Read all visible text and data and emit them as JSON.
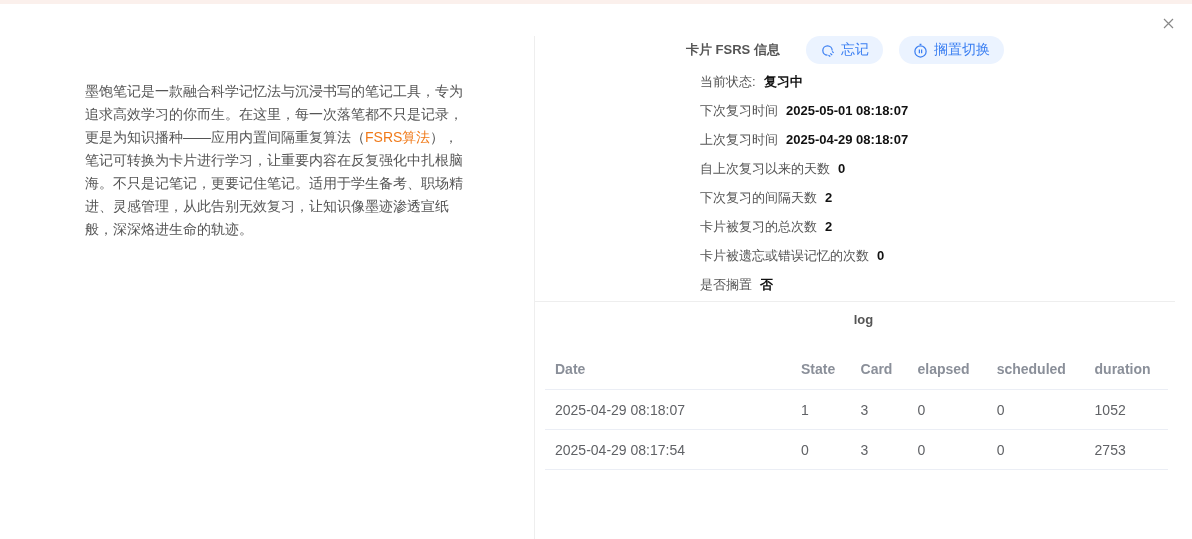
{
  "intro": {
    "before": "墨饱笔记是一款融合科学记忆法与沉浸书写的笔记工具，专为追求高效学习的你而生。在这里，每一次落笔都不只是记录，更是为知识播种——应用内置间隔重复算法（",
    "link": "FSRS算法",
    "after": "），笔记可转换为卡片进行学习，让重要内容在反复强化中扎根脑海。不只是记笔记，更要记住笔记。适用于学生备考、职场精进、灵感管理，从此告别无效复习，让知识像墨迹渗透宣纸般，深深烙进生命的轨迹。"
  },
  "info": {
    "title": "卡片 FSRS 信息",
    "buttons": [
      {
        "label": "忘记",
        "kind": "forget"
      },
      {
        "label": "搁置切换",
        "kind": "suspend"
      }
    ],
    "rows": [
      {
        "label": "当前状态:",
        "value": "复习中"
      },
      {
        "label": "下次复习时间",
        "value": "2025-05-01 08:18:07"
      },
      {
        "label": "上次复习时间",
        "value": "2025-04-29 08:18:07"
      },
      {
        "label": "自上次复习以来的天数",
        "value": "0"
      },
      {
        "label": "下次复习的间隔天数",
        "value": "2"
      },
      {
        "label": "卡片被复习的总次数",
        "value": "2"
      },
      {
        "label": "卡片被遗忘或错误记忆的次数",
        "value": "0"
      },
      {
        "label": "是否搁置",
        "value": "否"
      }
    ]
  },
  "log": {
    "title": "log",
    "columns": [
      "Date",
      "State",
      "Card",
      "elapsed",
      "scheduled",
      "duration"
    ],
    "rows": [
      [
        "2025-04-29 08:18:07",
        "1",
        "3",
        "0",
        "0",
        "1052"
      ],
      [
        "2025-04-29 08:17:54",
        "0",
        "3",
        "0",
        "0",
        "2753"
      ]
    ]
  }
}
